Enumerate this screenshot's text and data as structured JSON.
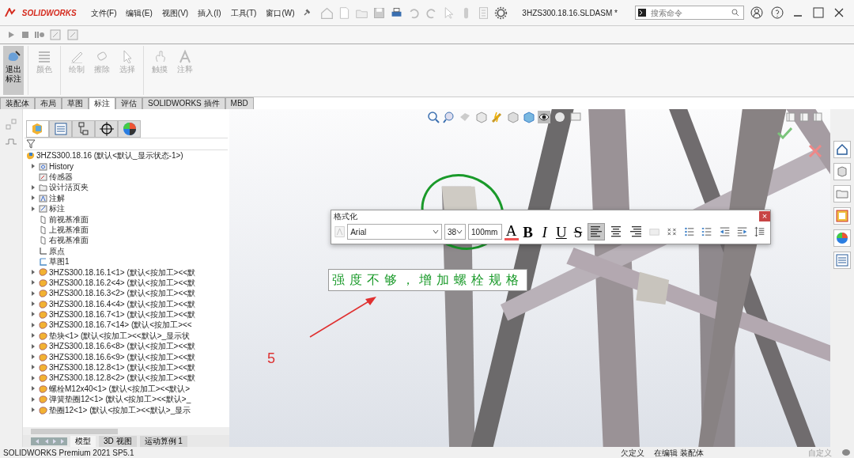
{
  "app": {
    "logo": "SOLIDWORKS"
  },
  "menu": [
    {
      "label": "文件(F)"
    },
    {
      "label": "编辑(E)"
    },
    {
      "label": "视图(V)"
    },
    {
      "label": "插入(I)"
    },
    {
      "label": "工具(T)"
    },
    {
      "label": "窗口(W)"
    }
  ],
  "window": {
    "title": "3HZS300.18.16.SLDASM *"
  },
  "search": {
    "placeholder": "搜索命令"
  },
  "ribbon": [
    {
      "label": "退出标注",
      "kind": "exit",
      "selected": true,
      "disabled": false
    },
    {
      "label": "颜色",
      "kind": "color",
      "selected": false,
      "disabled": true
    },
    {
      "label": "绘制",
      "kind": "draw",
      "selected": false,
      "disabled": true
    },
    {
      "label": "擦除",
      "kind": "erase",
      "selected": false,
      "disabled": true
    },
    {
      "label": "选择",
      "kind": "select",
      "selected": false,
      "disabled": true
    },
    {
      "label": "触摸",
      "kind": "touch",
      "selected": false,
      "disabled": true
    },
    {
      "label": "注释",
      "kind": "note",
      "selected": false,
      "disabled": true
    }
  ],
  "command_tabs": [
    {
      "label": "装配体",
      "selected": false
    },
    {
      "label": "布局",
      "selected": false
    },
    {
      "label": "草图",
      "selected": false
    },
    {
      "label": "标注",
      "selected": true
    },
    {
      "label": "评估",
      "selected": false
    },
    {
      "label": "SOLIDWORKS 插件",
      "selected": false
    },
    {
      "label": "MBD",
      "selected": false
    }
  ],
  "tree": {
    "root": "3HZS300.18.16  (默认<默认_显示状态-1>)",
    "items": [
      {
        "label": "History",
        "kind": "history",
        "expandable": true
      },
      {
        "label": "传感器",
        "kind": "sensor",
        "expandable": false
      },
      {
        "label": "设计活页夹",
        "kind": "folder",
        "expandable": true
      },
      {
        "label": "注解",
        "kind": "annotation",
        "expandable": true
      },
      {
        "label": "标注",
        "kind": "markup",
        "expandable": true
      },
      {
        "label": "前视基准面",
        "kind": "plane",
        "expandable": false
      },
      {
        "label": "上视基准面",
        "kind": "plane",
        "expandable": false
      },
      {
        "label": "右视基准面",
        "kind": "plane",
        "expandable": false
      },
      {
        "label": "原点",
        "kind": "origin",
        "expandable": false
      },
      {
        "label": "草图1",
        "kind": "sketch",
        "expandable": false
      },
      {
        "label": "3HZS300.18.16.1<1> (默认<按加工><<默",
        "kind": "part",
        "expandable": true
      },
      {
        "label": "3HZS300.18.16.2<4> (默认<按加工><<默",
        "kind": "part",
        "expandable": true
      },
      {
        "label": "3HZS300.18.16.3<2> (默认<按加工><<默",
        "kind": "part",
        "expandable": true
      },
      {
        "label": "3HZS300.18.16.4<4> (默认<按加工><<默",
        "kind": "part",
        "expandable": true
      },
      {
        "label": "3HZS300.18.16.7<1> (默认<按加工><<默",
        "kind": "part",
        "expandable": true
      },
      {
        "label": "3HZS300.18.16.7<14> (默认<按加工><<",
        "kind": "part",
        "expandable": true
      },
      {
        "label": "垫块<1> (默认<按加工><<默认>_显示状",
        "kind": "part",
        "expandable": true
      },
      {
        "label": "3HZS300.18.16.6<8> (默认<按加工><<默",
        "kind": "part",
        "expandable": true
      },
      {
        "label": "3HZS300.18.16.6<9> (默认<按加工><<默",
        "kind": "part",
        "expandable": true
      },
      {
        "label": "3HZS300.18.12.8<1> (默认<按加工><<默",
        "kind": "part",
        "expandable": true
      },
      {
        "label": "3HZS300.18.12.8<2> (默认<按加工><<默",
        "kind": "part",
        "expandable": true
      },
      {
        "label": "螺栓M12x40<1> (默认<按加工><<默认>",
        "kind": "part",
        "expandable": true
      },
      {
        "label": "弹簧垫圈12<1> (默认<按加工><<默认>_",
        "kind": "part",
        "expandable": true
      },
      {
        "label": "垫圈12<1> (默认<按加工><<默认>_显示",
        "kind": "part",
        "expandable": true
      }
    ]
  },
  "bottom_tabs": [
    {
      "label": "模型",
      "selected": true
    },
    {
      "label": "3D 视图",
      "selected": false
    },
    {
      "label": "运动算例 1",
      "selected": false
    }
  ],
  "format_dialog": {
    "title": "格式化",
    "close": "×",
    "font": "Arial",
    "size": "38",
    "height": "100mm",
    "style_buttons": [
      {
        "label": "A",
        "kind": "color"
      },
      {
        "label": "B",
        "kind": "bold"
      },
      {
        "label": "I",
        "kind": "italic"
      },
      {
        "label": "U",
        "kind": "underline"
      },
      {
        "label": "S",
        "kind": "strike"
      }
    ],
    "align_buttons": [
      {
        "kind": "left",
        "selected": true
      },
      {
        "kind": "center",
        "selected": false
      },
      {
        "kind": "right",
        "selected": false
      }
    ]
  },
  "note": {
    "text": "强度不够，增加螺栓规格"
  },
  "markup": {
    "number": "5"
  },
  "status_bar": {
    "product": "SOLIDWORKS Premium 2021 SP5.1",
    "state": "欠定义",
    "mode": "在编辑 装配体",
    "units": "自定义"
  }
}
